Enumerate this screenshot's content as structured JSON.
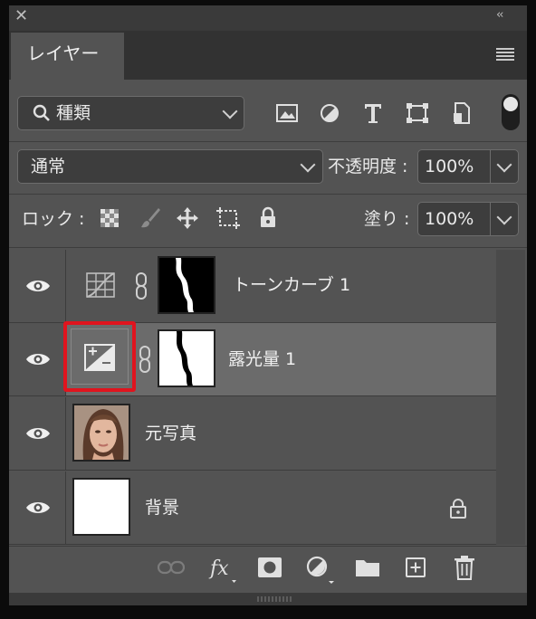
{
  "panel": {
    "tab_label": "レイヤー"
  },
  "filter": {
    "kind_label": "種類"
  },
  "blend": {
    "mode": "通常",
    "opacity_label": "不透明度 :",
    "opacity_value": "100%"
  },
  "lock": {
    "label": "ロック :",
    "fill_label": "塗り :",
    "fill_value": "100%"
  },
  "layers": [
    {
      "name": "トーンカーブ 1",
      "type": "adjustment-curves",
      "visible": true,
      "selected": false
    },
    {
      "name": "露光量 1",
      "type": "adjustment-exposure",
      "visible": true,
      "selected": true
    },
    {
      "name": "元写真",
      "type": "image",
      "visible": true,
      "selected": false
    },
    {
      "name": "背景",
      "type": "background",
      "visible": true,
      "selected": false,
      "locked": true
    }
  ],
  "colors": {
    "panel_bg": "#535353",
    "selected_row": "#6b6b6b",
    "highlight_box": "#e0141e"
  }
}
